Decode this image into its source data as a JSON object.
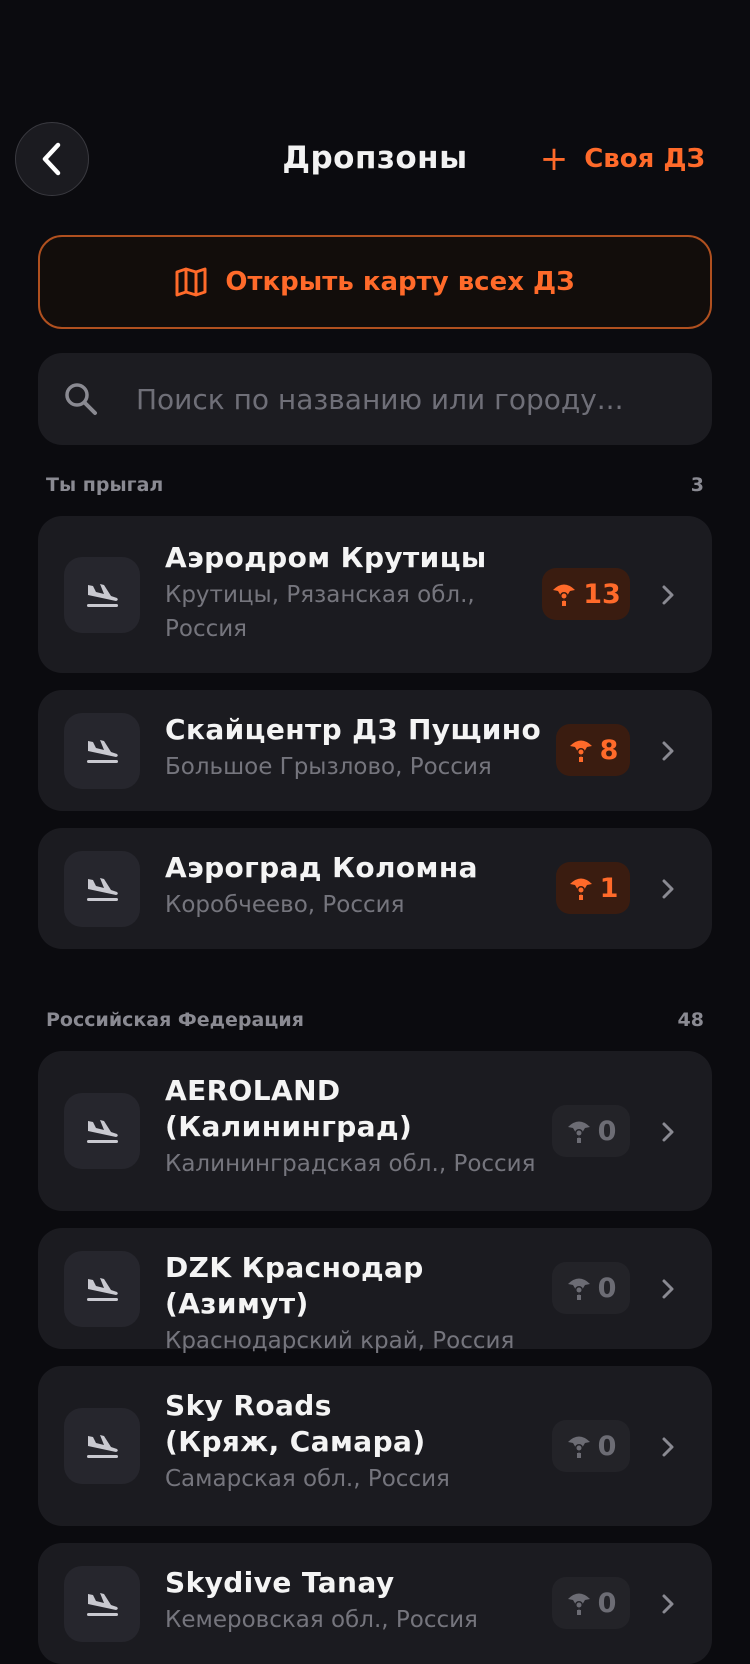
{
  "header": {
    "title": "Дропзоны",
    "add_label": "Своя ДЗ"
  },
  "map_button": {
    "label": "Открыть карту всех ДЗ"
  },
  "search": {
    "placeholder": "Поиск по названию или городу..."
  },
  "sections": [
    {
      "title": "Ты прыгал",
      "count": "3",
      "items": [
        {
          "name": "Аэродром Крутицы",
          "location": "Крутицы, Рязанская обл., Россия",
          "jumps": "13"
        },
        {
          "name": "Скайцентр ДЗ Пущино",
          "location": "Большое Грызлово, Россия",
          "jumps": "8"
        },
        {
          "name": "Аэроград Коломна",
          "location": "Коробчеево, Россия",
          "jumps": "1"
        }
      ]
    },
    {
      "title": "Российская Федерация",
      "count": "48",
      "items": [
        {
          "name": "AEROLAND (Калининград)",
          "location": "Калининградская обл., Россия",
          "jumps": "0"
        },
        {
          "name": "DZK Краснодар (Азимут)",
          "location": "Краснодарский край, Россия",
          "jumps": "0"
        },
        {
          "name": "Sky Roads (Кряж, Самара)",
          "location": "Самарская обл., Россия",
          "jumps": "0"
        },
        {
          "name": "Skydive Tanay",
          "location": "Кемеровская обл., Россия",
          "jumps": "0"
        }
      ]
    }
  ],
  "icons": {
    "back": "chevron-left-icon",
    "add": "plus-icon",
    "map": "map-icon",
    "search": "search-icon",
    "dropzone": "plane-landing-icon",
    "jumps": "parachutist-icon",
    "row_arrow": "chevron-right-icon"
  },
  "colors": {
    "accent": "#ff6a2a",
    "background": "#0b0b0f",
    "card": "#1b1b20"
  }
}
